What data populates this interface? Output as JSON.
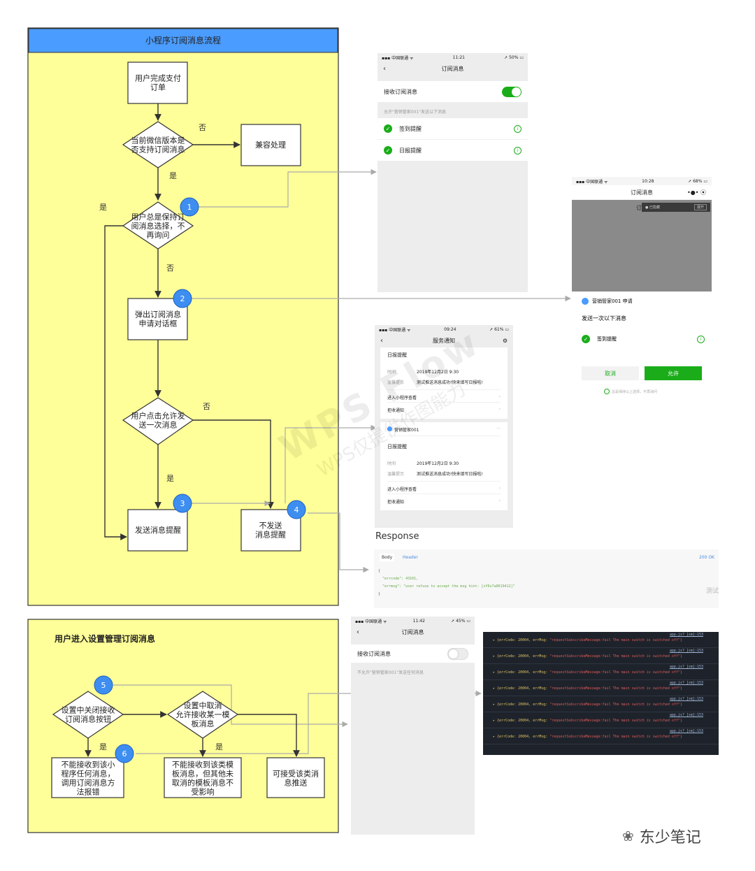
{
  "main_flow": {
    "title": "小程序订阅消息流程",
    "nodes": {
      "n_pay": [
        "用户完成支付",
        "订单"
      ],
      "n_check_version": [
        "当前微信版本是",
        "否支持订阅消息"
      ],
      "n_compat": [
        "兼容处理"
      ],
      "n_always_keep": [
        "用户总是保持订",
        "阅消息选择，不",
        "再询问"
      ],
      "n_popup": [
        "弹出订阅消息",
        "申请对话框"
      ],
      "n_user_allow": [
        "用户点击允许发",
        "送一次消息"
      ],
      "n_send": [
        "发送消息提醒"
      ],
      "n_not_send": [
        "不发送",
        "消息提醒"
      ]
    },
    "labels": {
      "yes": "是",
      "no": "否"
    },
    "badges": [
      "1",
      "2",
      "3",
      "4"
    ]
  },
  "settings_flow": {
    "title": "用户进入设置管理订阅消息",
    "nodes": {
      "s_close_all": [
        "设置中关闭接收",
        "订阅消息按钮"
      ],
      "s_cancel_one": [
        "设置中取消",
        "允许接收某一模",
        "板消息"
      ],
      "s_no_receive_any": [
        "不能接收到该小",
        "程序任何消息，",
        "调用订阅消息方",
        "法报错"
      ],
      "s_no_receive_tpl": [
        "不能接收到该类模",
        "板消息，但其他未",
        "取消的模板消息不",
        "受影响"
      ],
      "s_can_receive": [
        "可接受该类消",
        "息推送"
      ]
    },
    "labels": {
      "yes": "是"
    },
    "badges": [
      "5",
      "6"
    ]
  },
  "phone1": {
    "carrier": "▪▪▪ 中国联通 ᯤ",
    "time": "11:21",
    "battery": "➚ 50% ▭",
    "title": "订阅消息",
    "receive_label": "接收订阅消息",
    "hint": "允许\"营销管家001\"发送以下消息",
    "items": [
      "签到提醒",
      "日报提醒"
    ]
  },
  "phone2": {
    "carrier": "▪▪▪ 中国联通 ᯤ",
    "time": "10:28",
    "battery": "➚ 68% ▭",
    "title": "订阅消息",
    "nav_right": "•●•   ⦿",
    "peek": "订",
    "dark_chip": "● 已隐藏",
    "dark_chip_btn": "展开",
    "applicant": "营销管家001 申请",
    "send_once": "发送一次以下消息",
    "item": "签到提醒",
    "cancel": "取消",
    "allow": "允许",
    "keep_choice": "总是保持以上选择，不再询问"
  },
  "phone3": {
    "carrier": "▪▪▪ 中国联通 ᯤ",
    "time": "09:24",
    "battery": "➚ 61% ▭",
    "title": "服务通知",
    "card_title": "日报提醒",
    "time_label": "时间",
    "time_value": "2019年12月2日 9:30",
    "tip_label": "温馨提示",
    "tip_value": "测试推送消息成功!快来填写日报啦!",
    "enter_link": "进入小程序查看",
    "reject_link": "拒收通知",
    "sender": "营销管家001",
    "more": "···"
  },
  "response": {
    "heading": "Response",
    "tab_body": "Body",
    "tab_header": "Header",
    "status": "200 OK",
    "code_lines": [
      "{",
      "  \"errcode\": 43101,",
      "  \"errmsg\": \"user refuse to accept the msg hint: [xY6s7a0619412]\"",
      "}"
    ],
    "side_text": "测试"
  },
  "phone4": {
    "carrier": "▪▪▪ 中国联通 ᯤ",
    "time": "11:42",
    "battery": "➚ 45% ▭",
    "title": "订阅消息",
    "receive_label": "接收订阅消息",
    "hint": "不允许\"营销管家001\"发送任何消息"
  },
  "console": {
    "source": "app.js? [sm]:153",
    "prefix": "{errCode: 20004, errMsg: ",
    "message": "\"requestSubscribeMessage:fail The main switch is switched off\"}",
    "line_count": 7
  },
  "watermark": {
    "line1": "WPS Flow",
    "line2": "WPS仅提供作图能力"
  },
  "brand": {
    "icon": "❀",
    "name": "东少笔记"
  },
  "colors": {
    "lane_fill": "#ffff99",
    "header_fill": "#4a9cff",
    "badge_fill": "#3d8ef0",
    "wechat_green": "#1aad19"
  }
}
